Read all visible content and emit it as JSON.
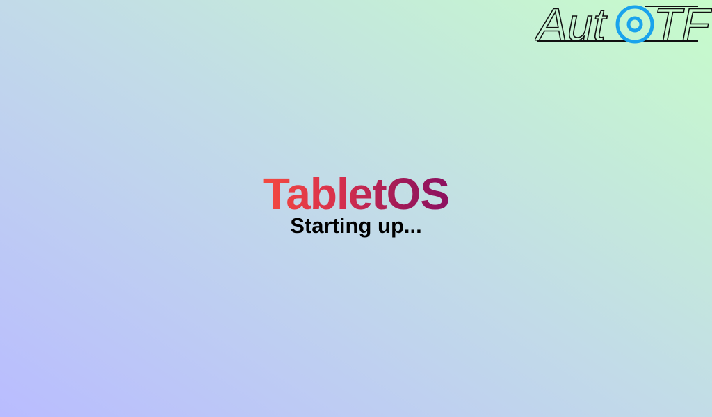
{
  "brand": {
    "name": "AutoTF",
    "text_left": "Aut",
    "text_right": "TF",
    "accent_color": "#1aa3ec",
    "icon": "target-circle-icon"
  },
  "boot": {
    "title": "TabletOS",
    "status": "Starting up..."
  },
  "colors": {
    "background_start": "#b9bcff",
    "background_mid": "#c2dbe8",
    "background_end": "#c7fcca",
    "title_gradient_start": "#f44a40",
    "title_gradient_end": "#8c1060",
    "status_text": "#000000"
  }
}
